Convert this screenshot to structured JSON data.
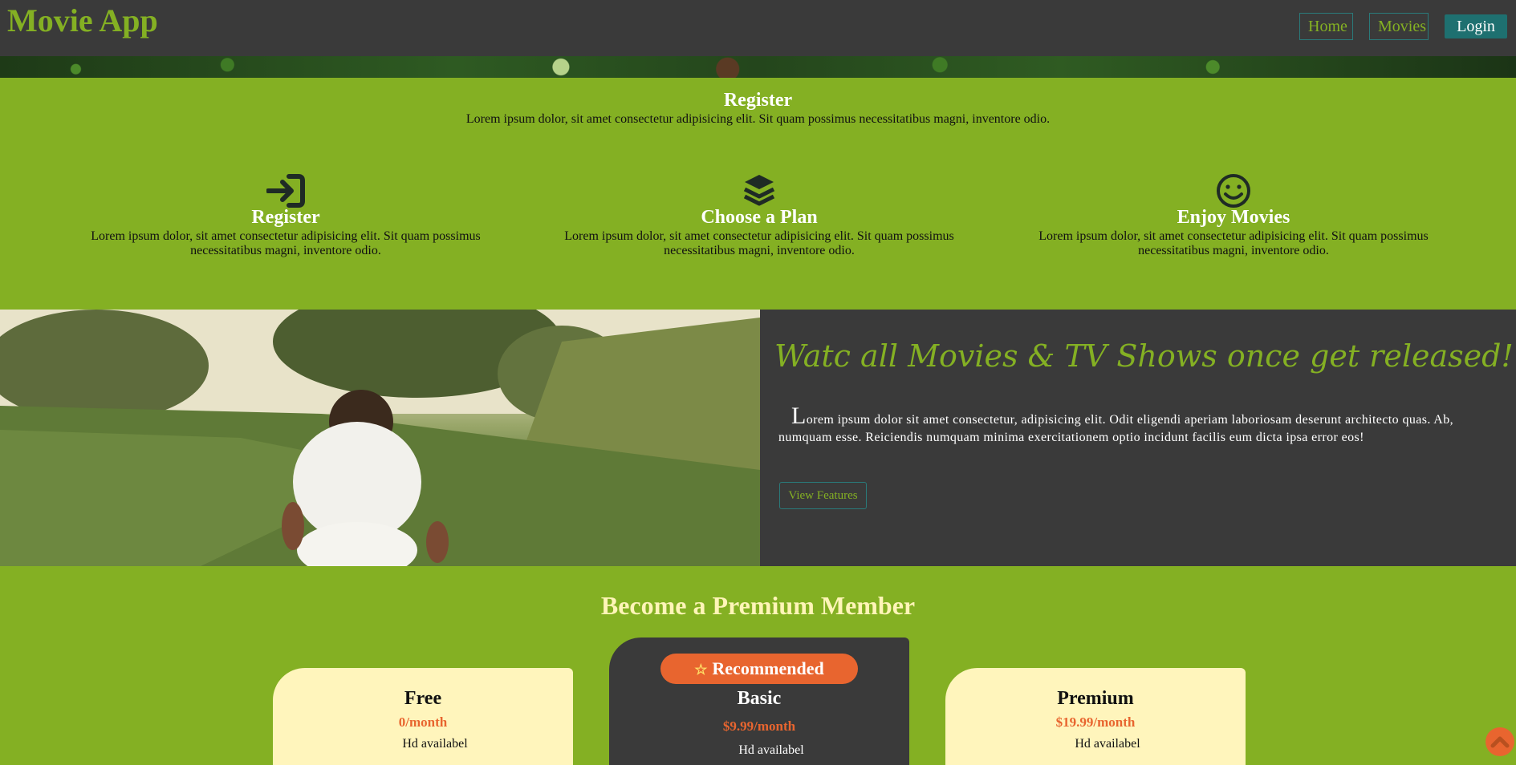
{
  "nav": {
    "brand": "Movie App",
    "home_label": "Home",
    "movies_label": "Movies",
    "login_label": "Login"
  },
  "how": {
    "title": "Register",
    "subtitle": "Lorem ipsum dolor, sit amet consectetur adipisicing elit. Sit quam possimus necessitatibus magni, inventore odio.",
    "steps": [
      {
        "icon": "sign-in-icon",
        "title": "Register",
        "text": "Lorem ipsum dolor, sit amet consectetur adipisicing elit. Sit quam possimus necessitatibus magni, inventore odio."
      },
      {
        "icon": "layers-icon",
        "title": "Choose a Plan",
        "text": "Lorem ipsum dolor, sit amet consectetur adipisicing elit. Sit quam possimus necessitatibus magni, inventore odio."
      },
      {
        "icon": "smiley-icon",
        "title": "Enjoy Movies",
        "text": "Lorem ipsum dolor, sit amet consectetur adipisicing elit. Sit quam possimus necessitatibus magni, inventore odio."
      }
    ]
  },
  "showcase": {
    "headline": "Watc all Movies & TV Shows once get released!",
    "dropcap": "L",
    "paragraph": "orem ipsum dolor sit amet consectetur, adipisicing elit. Odit eligendi aperiam laboriosam deserunt architecto quas. Ab, numquam esse. Reiciendis numquam minima exercitationem optio incidunt facilis eum dicta ipsa error eos!",
    "button_label": "View Features"
  },
  "premium": {
    "title": "Become a Premium Member",
    "badge": "Recommended",
    "plans": [
      {
        "name": "Free",
        "price": "0/month",
        "feature": "Hd availabel"
      },
      {
        "name": "Basic",
        "price": "$9.99/month",
        "feature": "Hd availabel"
      },
      {
        "name": "Premium",
        "price": "$19.99/month",
        "feature": "Hd availabel"
      }
    ]
  },
  "colors": {
    "accent_green": "#84b023",
    "dark": "#3a3a3a",
    "teal": "#1e7070",
    "orange": "#e8652f",
    "cream": "#fff5bc"
  }
}
